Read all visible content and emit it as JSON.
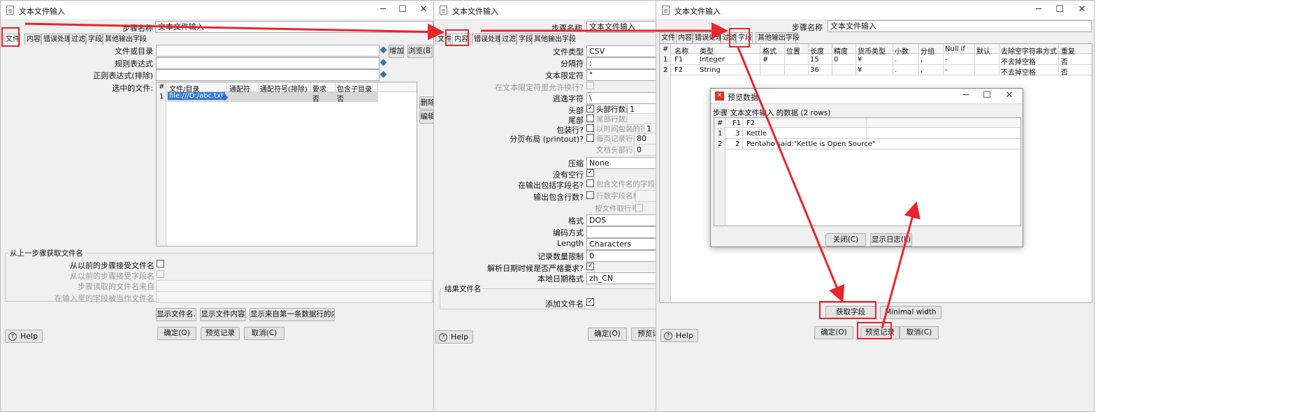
{
  "step_name_label": "步骤名称",
  "step_name_value": "文本文件输入",
  "tabs": [
    "文件",
    "内容",
    "错误处理",
    "过滤",
    "字段",
    "其他输出字段"
  ],
  "help_label": "Help",
  "window_controls": {
    "minimize": "─",
    "maximize": "☐",
    "close": "✕"
  },
  "win1": {
    "title": "文本文件输入",
    "file_or_dir_label": "文件或目录",
    "regex_label": "规则表达式",
    "regex_exclude_label": "正则表达式(排除)",
    "selected_files_label": "选中的文件:",
    "add_button": "增加",
    "browse_button": "浏览(B)...",
    "delete_button": "删除",
    "edit_button": "编辑",
    "table_headers": [
      "#",
      "文件/目录",
      "通配符",
      "通配符号(排除)",
      "要求",
      "包含子目录"
    ],
    "table_rows": [
      [
        "1",
        "file:///D:/abc.txt",
        "",
        "",
        "否",
        "否"
      ]
    ],
    "prev_step_group": "从上一步骤获取文件名",
    "accept_from_prev_label": "从以前的步骤接受文件名",
    "accept_field_label": "从以前的步骤接受字段名",
    "step_read_label": "步骤读取的文件名来自",
    "field_as_filename_label": "在输入里的字段被当作文件名",
    "show_filenames_button": "显示文件名...",
    "show_content_button": "显示文件内容",
    "show_first_row_button": "显示来自第一条数据行的内容",
    "ok_button": "确定(O)",
    "preview_button": "预览记录",
    "cancel_button": "取消(C)"
  },
  "win2": {
    "title": "文本文件输入",
    "file_type_label": "文件类型",
    "file_type_value": "CSV",
    "separator_label": "分隔符",
    "separator_value": ";",
    "enclosure_label": "文本限定符",
    "enclosure_value": "\"",
    "allow_breaks_label": "在文本限定符里允许换行?",
    "escape_label": "逃逸字符",
    "escape_value": "\\",
    "header_label": "头部",
    "header_rows_label": "头部行数量",
    "header_rows_value": "1",
    "footer_label": "尾部",
    "footer_rows_label": "尾部行数量",
    "wrap_label": "包装行?",
    "wrap_count_label": "以时间包装的行数",
    "wrap_count_value": "1",
    "paged_label": "分页布局 (printout)?",
    "page_lines_label": "每页记录行数",
    "page_lines_value": "80",
    "doc_header_label": "文档头部行",
    "doc_header_value": "0",
    "compression_label": "压缩",
    "compression_value": "None",
    "no_empty_label": "没有空行",
    "include_filename_label": "在输出包括字段名?",
    "filename_field_label": "包含文件名的字段名称",
    "output_rownum_label": "输出包含行数?",
    "rownum_field_label": "行数字段名称",
    "rownum_by_file_label": "按文件取行号",
    "format_label": "格式",
    "format_value": "DOS",
    "encoding_label": "编码方式",
    "encoding_value": "",
    "length_label": "Length",
    "length_value": "Characters",
    "limit_label": "记录数量限制",
    "limit_value": "0",
    "lenient_date_label": "解析日期时候是否严格要求?",
    "locale_label": "本地日期格式",
    "locale_value": "zh_CN",
    "result_group": "结果文件名",
    "add_filenames_label": "添加文件名",
    "ok_button": "确定(O)",
    "preview_button": "预览记"
  },
  "win3": {
    "title": "文本文件输入",
    "field_headers": [
      "#",
      "名称",
      "类型",
      "格式",
      "位置",
      "长度",
      "精度",
      "货币类型",
      "小数",
      "分组",
      "Null if",
      "默认",
      "去除空字符串方式",
      "重复"
    ],
    "field_rows": [
      [
        "1",
        "F1",
        "Integer",
        "#",
        "",
        "15",
        "0",
        "¥",
        ".",
        ",",
        "-",
        "",
        "不去掉空格",
        "否"
      ],
      [
        "2",
        "F2",
        "String",
        "",
        "",
        "36",
        "",
        "¥",
        ".",
        ",",
        "-",
        "",
        "不去掉空格",
        "否"
      ]
    ],
    "get_fields_button": "获取字段",
    "minimal_width_button": "Minimal width",
    "ok_button": "确定(O)",
    "preview_button": "预览记录",
    "cancel_button": "取消(C)"
  },
  "preview": {
    "title": "预览数据",
    "subtitle": "步骤 文本文件输入 的数据  (2 rows)",
    "headers": [
      "#",
      "F1",
      "F2"
    ],
    "rows": [
      [
        "1",
        "3",
        "Kettle"
      ],
      [
        "2",
        "2",
        "Pentaho said:\"Kettle is Open Source\""
      ]
    ],
    "close_button": "关闭(C)",
    "show_log_button": "显示日志(L)"
  },
  "accent_color": "#e8252c"
}
